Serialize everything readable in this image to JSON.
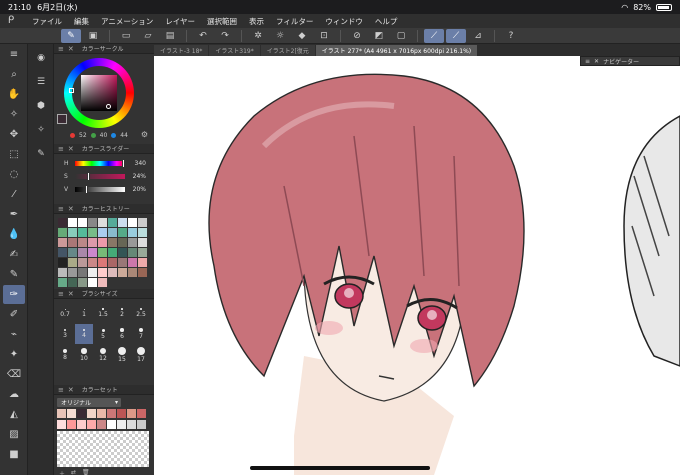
{
  "status": {
    "time": "21:10",
    "date": "6月2日(水)",
    "battery": "82%"
  },
  "menu": [
    "ファイル",
    "編集",
    "アニメーション",
    "レイヤー",
    "選択範囲",
    "表示",
    "フィルター",
    "ウィンドウ",
    "ヘルプ"
  ],
  "tabs": [
    {
      "label": "イラスト-3 18*",
      "active": false
    },
    {
      "label": "イラスト319*",
      "active": false
    },
    {
      "label": "イラスト2[復元",
      "active": false
    },
    {
      "label": "イラスト 277* (A4 4961 x 7016px 600dpi 216.1%)",
      "active": true
    }
  ],
  "panels": {
    "color_circle": {
      "title": "カラーサークル",
      "h": "52",
      "s": "40",
      "v": "44"
    },
    "color_slider": {
      "title": "カラースライダー",
      "rows": [
        {
          "label": "H",
          "value": "340",
          "pos": 0.94
        },
        {
          "label": "S",
          "value": "24%",
          "pos": 0.24
        },
        {
          "label": "V",
          "value": "20%",
          "pos": 0.2
        }
      ]
    },
    "color_history": {
      "title": "カラーヒストリー"
    },
    "brush_size": {
      "title": "ブラシサイズ",
      "sizes": [
        "0.7",
        "1",
        "1.5",
        "2",
        "2.5",
        "3",
        "4",
        "5",
        "6",
        "7",
        "8",
        "10",
        "12",
        "15",
        "17"
      ],
      "selected": "4"
    },
    "color_set": {
      "title": "カラーセット",
      "selected": "オリジナル"
    }
  },
  "navigator": {
    "title": "ナビゲーター"
  },
  "colors": {
    "hair": "#c8727a",
    "skin": "#f7e6dc",
    "eye": "#c2385e",
    "accent": "#5b6e96"
  }
}
